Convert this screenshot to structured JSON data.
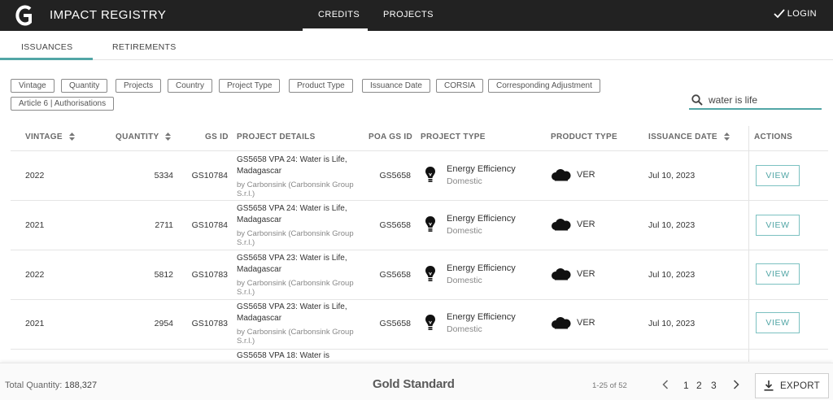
{
  "app": {
    "brand": "IMPACT REGISTRY",
    "nav": {
      "credits": "CREDITS",
      "projects": "PROJECTS"
    },
    "login": "LOGIN"
  },
  "subtabs": {
    "issuances": "ISSUANCES",
    "retirements": "RETIREMENTS"
  },
  "filters": [
    "Vintage",
    "Quantity",
    "Projects",
    "Country",
    "Project Type",
    "Product Type",
    "Issuance Date",
    "CORSIA",
    "Corresponding Adjustment",
    "Article 6 | Authorisations"
  ],
  "search": {
    "value": "water is life"
  },
  "table": {
    "headers": {
      "vintage": "VINTAGE",
      "quantity": "QUANTITY",
      "gs_id": "GS ID",
      "project_details": "PROJECT DETAILS",
      "poa_gs_id": "POA GS ID",
      "project_type": "PROJECT TYPE",
      "product_type": "PRODUCT TYPE",
      "issuance_date": "ISSUANCE DATE",
      "actions": "ACTIONS"
    },
    "rows": [
      {
        "vintage": "2022",
        "quantity": "5334",
        "gs_id": "GS10784",
        "project": "GS5658 VPA 24: Water is Life, Madagascar",
        "by": "by Carbonsink (Carbonsink Group S.r.l.)",
        "poa": "GS5658",
        "ptype": "Energy Efficiency",
        "ptype_sub": "Domestic",
        "product": "VER",
        "date": "Jul 10, 2023",
        "action": "VIEW"
      },
      {
        "vintage": "2021",
        "quantity": "2711",
        "gs_id": "GS10784",
        "project": "GS5658 VPA 24: Water is Life, Madagascar",
        "by": "by Carbonsink (Carbonsink Group S.r.l.)",
        "poa": "GS5658",
        "ptype": "Energy Efficiency",
        "ptype_sub": "Domestic",
        "product": "VER",
        "date": "Jul 10, 2023",
        "action": "VIEW"
      },
      {
        "vintage": "2022",
        "quantity": "5812",
        "gs_id": "GS10783",
        "project": "GS5658 VPA 23: Water is Life, Madagascar",
        "by": "by Carbonsink (Carbonsink Group S.r.l.)",
        "poa": "GS5658",
        "ptype": "Energy Efficiency",
        "ptype_sub": "Domestic",
        "product": "VER",
        "date": "Jul 10, 2023",
        "action": "VIEW"
      },
      {
        "vintage": "2021",
        "quantity": "2954",
        "gs_id": "GS10783",
        "project": "GS5658 VPA 23: Water is Life, Madagascar",
        "by": "by Carbonsink (Carbonsink Group S.r.l.)",
        "poa": "GS5658",
        "ptype": "Energy Efficiency",
        "ptype_sub": "Domestic",
        "product": "VER",
        "date": "Jul 10, 2023",
        "action": "VIEW"
      },
      {
        "project": "GS5658 VPA 18: Water is"
      }
    ]
  },
  "footer": {
    "total_label": "Total Quantity:",
    "total_value": "188,327",
    "logo_text": "Gold Standard",
    "range": "1-25 of 52",
    "pages": [
      "1",
      "2",
      "3"
    ],
    "export": "EXPORT"
  },
  "colors": {
    "topbar": "#222222",
    "accent": "#52a6a6"
  }
}
